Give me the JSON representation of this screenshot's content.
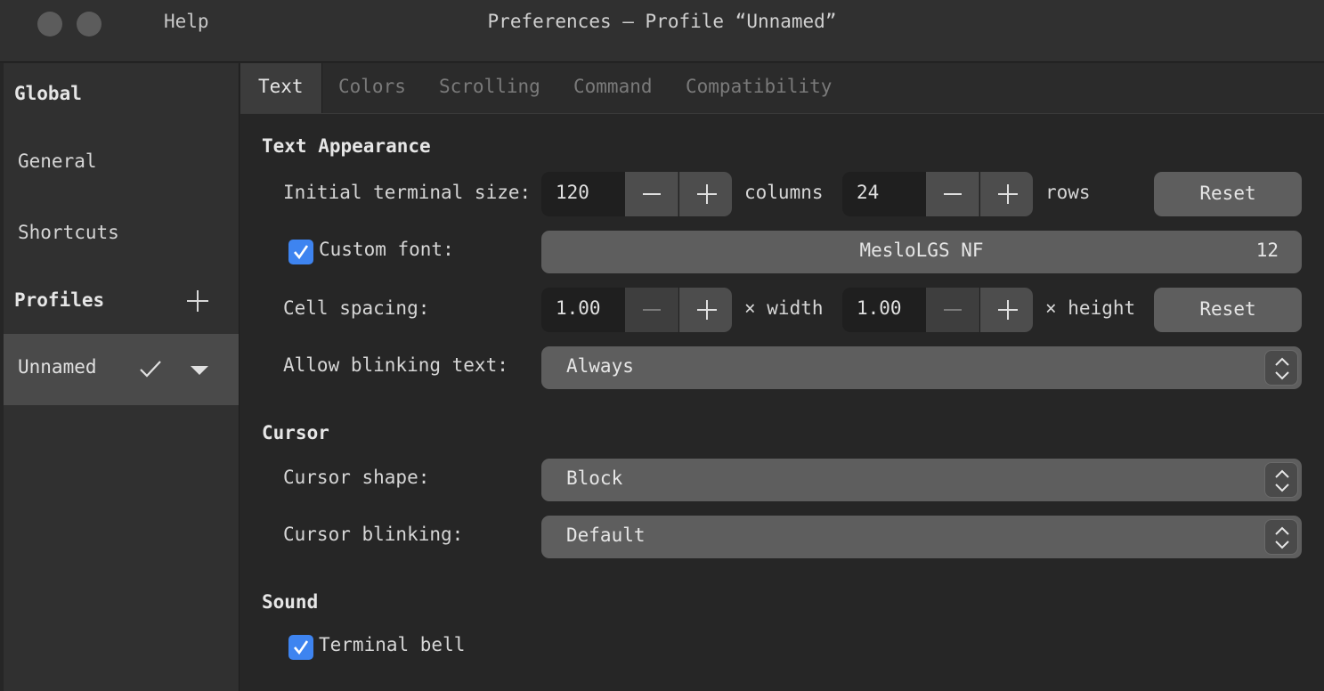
{
  "window": {
    "title": "Preferences — Profile “Unnamed”",
    "menu_help": "Help"
  },
  "sidebar": {
    "global_header": "Global",
    "items": [
      "General",
      "Shortcuts"
    ],
    "profiles_header": "Profiles",
    "selected_profile": "Unnamed"
  },
  "tabs": [
    "Text",
    "Colors",
    "Scrolling",
    "Command",
    "Compatibility"
  ],
  "text_appearance": {
    "section_title": "Text Appearance",
    "initial_size_label": "Initial terminal size:",
    "columns_value": "120",
    "columns_unit": "columns",
    "rows_value": "24",
    "rows_unit": "rows",
    "reset_label": "Reset",
    "custom_font_label": "Custom font:",
    "font_name": "MesloLGS NF",
    "font_size": "12",
    "cell_spacing_label": "Cell spacing:",
    "width_value": "1.00",
    "width_unit": "× width",
    "height_value": "1.00",
    "height_unit": "× height",
    "blinking_label": "Allow blinking text:",
    "blinking_value": "Always"
  },
  "cursor": {
    "section_title": "Cursor",
    "shape_label": "Cursor shape:",
    "shape_value": "Block",
    "blinking_label": "Cursor blinking:",
    "blinking_value": "Default"
  },
  "sound": {
    "section_title": "Sound",
    "bell_label": "Terminal bell"
  },
  "colors": {
    "checkbox_accent": "#3e84f0"
  }
}
